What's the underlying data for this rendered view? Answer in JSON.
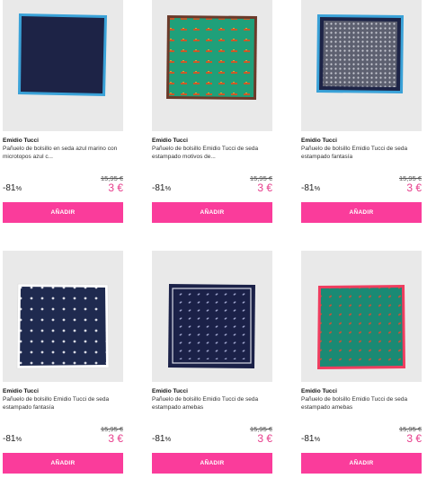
{
  "products": [
    {
      "brand": "Emidio Tucci",
      "description": "Pañuelo de bolsillo en seda azul marino con microtopos azul c...",
      "old_price": "15,95 €",
      "discount": "-81",
      "discount_unit": "%",
      "price": "3 €",
      "add_label": "AÑADIR",
      "pattern": "navy-microdots",
      "colors": {
        "fill": "#1d2346",
        "border": "#3aa2d8"
      }
    },
    {
      "brand": "Emidio Tucci",
      "description": "Pañuelo de bolsillo Emidio Tucci de seda estampado motivos de...",
      "old_price": "15,95 €",
      "discount": "-81",
      "discount_unit": "%",
      "price": "3 €",
      "add_label": "AÑADIR",
      "pattern": "green-motifs",
      "colors": {
        "fill": "#1fa07a",
        "border": "#6b3a2a"
      }
    },
    {
      "brand": "Emidio Tucci",
      "description": "Pañuelo de bolsillo Emidio Tucci de seda estampado fantasía",
      "old_price": "15,95 €",
      "discount": "-81",
      "discount_unit": "%",
      "price": "3 €",
      "add_label": "AÑADIR",
      "pattern": "grey-dots",
      "colors": {
        "fill": "#6b6d78",
        "border": "#3aa2d8"
      }
    },
    {
      "brand": "Emidio Tucci",
      "description": "Pañuelo de bolsillo Emidio Tucci de seda estampado fantasía",
      "old_price": "15,95 €",
      "discount": "-81",
      "discount_unit": "%",
      "price": "3 €",
      "add_label": "AÑADIR",
      "pattern": "navy-polka",
      "colors": {
        "fill": "#1f2a4f",
        "border": "#ffffff"
      }
    },
    {
      "brand": "Emidio Tucci",
      "description": "Pañuelo de bolsillo Emidio Tucci de seda estampado amebas",
      "old_price": "15,95 €",
      "discount": "-81",
      "discount_unit": "%",
      "price": "3 €",
      "add_label": "AÑADIR",
      "pattern": "navy-paisley",
      "colors": {
        "fill": "#1b2148",
        "border": "#d8dbe6"
      }
    },
    {
      "brand": "Emidio Tucci",
      "description": "Pañuelo de bolsillo Emidio Tucci de seda estampado amebas",
      "old_price": "15,95 €",
      "discount": "-81",
      "discount_unit": "%",
      "price": "3 €",
      "add_label": "AÑADIR",
      "pattern": "green-paisley",
      "colors": {
        "fill": "#1a8a74",
        "border": "#ef3d5f"
      }
    }
  ],
  "accent_color": "#fa3c9b",
  "sale_price_color": "#e73c8b"
}
